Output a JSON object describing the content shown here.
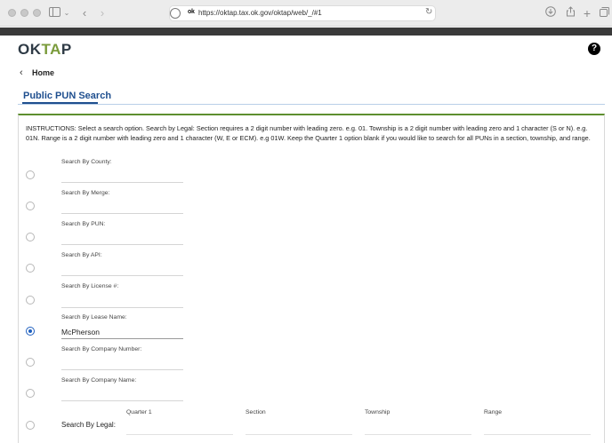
{
  "browser": {
    "url": "https://oktap.tax.ok.gov/oktap/web/_/#1",
    "favicon_text": "ok"
  },
  "app": {
    "logo_part1": "OK",
    "logo_part2": "TA",
    "logo_part3": "P",
    "help_label": "?",
    "back_label": "Home",
    "tab_title": "Public PUN Search"
  },
  "instructions": "INSTRUCTIONS: Select a search option. Search by Legal: Section requires a 2 digit number with leading zero. e.g. 01. Township is a 2 digit number with leading zero and 1 character (S or N). e.g. 01N. Range is a 2 digit number with leading zero and 1 character (W, E or ECM). e.g 01W. Keep the Quarter 1 option blank if you would like to search for all PUNs in a section, township, and range.",
  "fields": [
    {
      "label": "Search By County:",
      "value": "",
      "selected": false
    },
    {
      "label": "Search By Merge:",
      "value": "",
      "selected": false
    },
    {
      "label": "Search By PUN:",
      "value": "",
      "selected": false
    },
    {
      "label": "Search By API:",
      "value": "",
      "selected": false
    },
    {
      "label": "Search By License #:",
      "value": "",
      "selected": false
    },
    {
      "label": "Search By Lease Name:",
      "value": "McPherson",
      "selected": true
    },
    {
      "label": "Search By Company Number:",
      "value": "",
      "selected": false
    },
    {
      "label": "Search By Company Name:",
      "value": "",
      "selected": false
    }
  ],
  "legal": {
    "label": "Search By Legal:",
    "columns": [
      "Quarter 1",
      "Section",
      "Township",
      "Range"
    ]
  },
  "colors": {
    "accent_blue": "#1f4f8f",
    "panel_green": "#5e8f2f",
    "radio_selected": "#1f5fbf"
  }
}
